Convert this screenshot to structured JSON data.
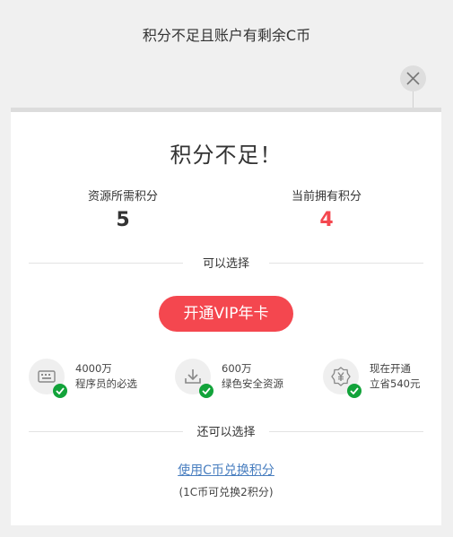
{
  "header": {
    "title": "积分不足且账户有剩余C币"
  },
  "dialog": {
    "title": "积分不足！",
    "required": {
      "label": "资源所需积分",
      "value": "5"
    },
    "current": {
      "label": "当前拥有积分",
      "value": "4"
    },
    "divider1": "可以选择",
    "vip_button": "开通VIP年卡",
    "features": [
      {
        "icon": "keyboard-icon",
        "line1": "4000万",
        "line2": "程序员的必选"
      },
      {
        "icon": "download-icon",
        "line1": "600万",
        "line2": "绿色安全资源"
      },
      {
        "icon": "yen-badge-icon",
        "line1": "现在开通",
        "line2": "立省540元"
      }
    ],
    "divider2": "还可以选择",
    "exchange_link": "使用C币兑换积分",
    "exchange_note": "(1C币可兑换2积分)"
  },
  "colors": {
    "accent_red": "#f4474f",
    "check_green": "#12a33a",
    "link_blue": "#4a7fc0"
  }
}
